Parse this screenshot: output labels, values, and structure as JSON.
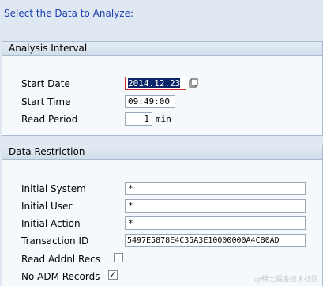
{
  "heading": "Select the Data to Analyze:",
  "analysis_interval": {
    "title": "Analysis Interval",
    "start_date_label": "Start Date",
    "start_date_value": "2014.12.23",
    "start_time_label": "Start Time",
    "start_time_value": "09:49:00",
    "read_period_label": "Read Period",
    "read_period_value": "1",
    "read_period_unit": "min"
  },
  "data_restriction": {
    "title": "Data Restriction",
    "initial_system_label": "Initial System",
    "initial_system_value": "*",
    "initial_user_label": "Initial User",
    "initial_user_value": "*",
    "initial_action_label": "Initial Action",
    "initial_action_value": "*",
    "transaction_id_label": "Transaction ID",
    "transaction_id_value": "5497E5878E4C35A3E10000000A4C80AD",
    "read_addnl_recs_label": "Read Addnl Recs",
    "read_addnl_recs_checked": "",
    "no_adm_records_label": "No ADM Records",
    "no_adm_records_checked": "✓"
  },
  "watermark": "@稀土掘金技术社区",
  "colors": {
    "heading": "#1f3fb0",
    "selection": "#0a246a",
    "focus_border": "#d43030"
  },
  "icons": {
    "date_picker": "calendar-icon"
  }
}
